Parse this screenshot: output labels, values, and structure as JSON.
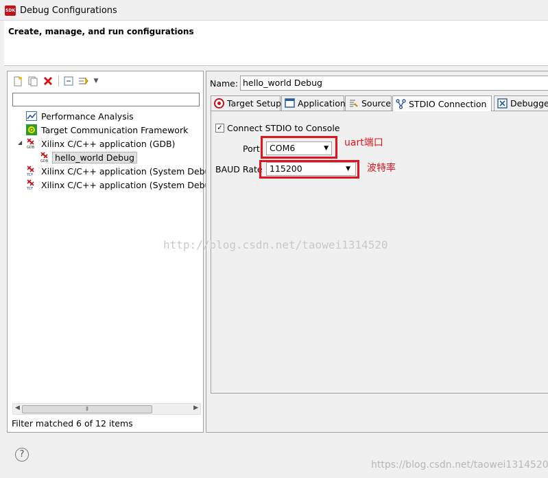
{
  "window": {
    "title": "Debug Configurations",
    "app_icon_text": "SDK"
  },
  "banner": {
    "heading": "Create, manage, and run configurations"
  },
  "left": {
    "filter_placeholder": "",
    "tree": [
      {
        "label": "Performance Analysis",
        "icon": "performance-chart-icon"
      },
      {
        "label": "Target Communication Framework",
        "icon": "tcf-framework-icon"
      },
      {
        "label": "Xilinx C/C++ application (GDB)",
        "icon": "xilinx-gdb-icon",
        "expanded": true
      },
      {
        "label": "hello_world Debug",
        "icon": "xilinx-gdb-icon",
        "selected": true
      },
      {
        "label": "Xilinx C/C++ application (System Debug",
        "icon": "xilinx-tcf-icon"
      },
      {
        "label": "Xilinx C/C++ application (System Debug",
        "icon": "xilinx-tcf-icon"
      }
    ],
    "filter_status": "Filter matched 6 of 12 items"
  },
  "right": {
    "name_label": "Name:",
    "name_value": "hello_world Debug",
    "tabs": [
      {
        "label": "Target Setup",
        "icon": "target-icon"
      },
      {
        "label": "Application",
        "icon": "application-icon"
      },
      {
        "label": "Source",
        "icon": "source-icon"
      },
      {
        "label": "STDIO Connection",
        "icon": "connection-icon",
        "active": true
      },
      {
        "label": "Debugger",
        "icon": "debugger-icon"
      }
    ],
    "stdio": {
      "connect_label": "Connect STDIO to Console",
      "connect_checked": true,
      "port_label": "Port",
      "port_value": "COM6",
      "baud_label": "BAUD Rate",
      "baud_value": "115200"
    }
  },
  "annotations": {
    "port_note": "uart端口",
    "baud_note": "波特率"
  },
  "watermarks": {
    "center": "http://blog.csdn.net/taowei1314520",
    "corner": "https://blog.csdn.net/taowei1314520"
  },
  "colors": {
    "annotation_red": "#e0141c",
    "xilinx_red": "#c0141a"
  }
}
